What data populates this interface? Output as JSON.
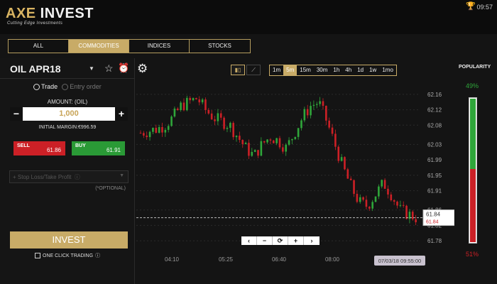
{
  "header": {
    "logo_axe": "AXE",
    "logo_invest": " INVEST",
    "tagline": "Cutting Edge Investments",
    "time": "09:57"
  },
  "tabs": [
    {
      "label": "ALL"
    },
    {
      "label": "COMMODITIES",
      "active": true
    },
    {
      "label": "INDICES"
    },
    {
      "label": "STOCKS"
    }
  ],
  "trade_panel": {
    "instrument": "OIL APR18",
    "mode_trade": "Trade",
    "mode_entry": "Entry order",
    "amount_label": "AMOUNT: (OIL)",
    "amount_value": "1,000",
    "minus": "−",
    "plus": "+",
    "initial_margin": "INITIAL MARGIN:€996.59",
    "sell_label": "SELL",
    "sell_price": "61.86",
    "buy_label": "BUY",
    "buy_price": "61.91",
    "stoploss_placeholder": "Stop Loss/Take Profit",
    "optional": "(*OPTIONAL)",
    "invest_label": "INVEST",
    "one_click": "ONE CLICK TRADING"
  },
  "chart_toolbar": {
    "timeframes": [
      "1m",
      "5m",
      "15m",
      "30m",
      "1h",
      "4h",
      "1d",
      "1w",
      "1mo"
    ],
    "active_timeframe": "5m",
    "active_type": "candle"
  },
  "popularity": {
    "label": "POPULARITY",
    "buy_pct": "49%",
    "sell_pct": "51%",
    "buy_value": 49,
    "sell_value": 51
  },
  "chart_data": {
    "type": "candlestick",
    "y_ticks": [
      "62.16",
      "62.12",
      "62.08",
      "62.03",
      "61.99",
      "61.95",
      "61.91",
      "61.86",
      "61.82",
      "61.78"
    ],
    "x_ticks": [
      "04:10",
      "05:25",
      "06:40",
      "08:00"
    ],
    "current_price": "61.84",
    "bid_price_tag": "61.84",
    "crosshair_time": "07/03/18 09:55:00",
    "ylim": [
      61.76,
      62.18
    ],
    "up_color": "#2fa63a",
    "down_color": "#cc2026"
  },
  "colors": {
    "accent": "#c8ab67",
    "sell": "#cc2026",
    "buy": "#2a9a36"
  }
}
